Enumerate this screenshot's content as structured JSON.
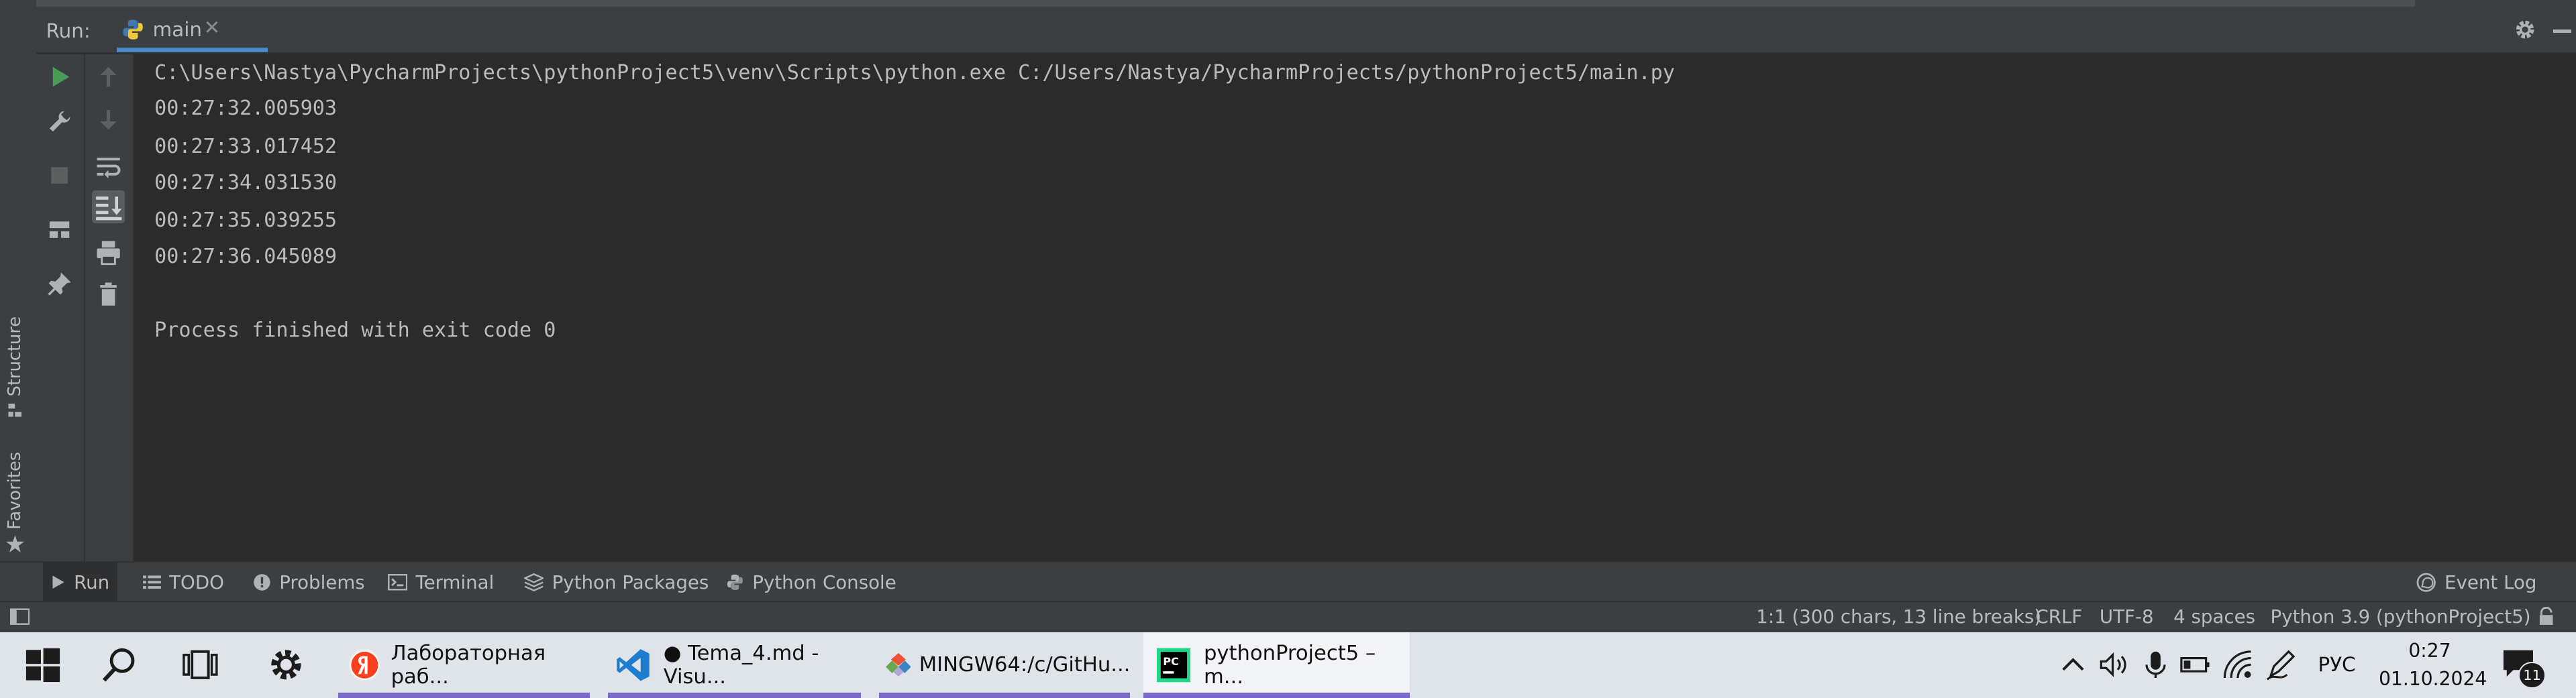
{
  "run_panel": {
    "label": "Run:",
    "tab_label": "main"
  },
  "side_tabs": {
    "structure": "Structure",
    "favorites": "Favorites"
  },
  "console_lines": [
    "C:\\Users\\Nastya\\PycharmProjects\\pythonProject5\\venv\\Scripts\\python.exe C:/Users/Nastya/PycharmProjects/pythonProject5/main.py",
    "00:27:32.005903",
    "00:27:33.017452",
    "00:27:34.031530",
    "00:27:35.039255",
    "00:27:36.045089",
    "",
    "Process finished with exit code 0"
  ],
  "bottom_tabs": [
    {
      "label": "Run",
      "icon": "play-icon"
    },
    {
      "label": "TODO",
      "icon": "list-icon"
    },
    {
      "label": "Problems",
      "icon": "problems-icon"
    },
    {
      "label": "Terminal",
      "icon": "terminal-icon"
    },
    {
      "label": "Python Packages",
      "icon": "packages-icon"
    },
    {
      "label": "Python Console",
      "icon": "python-console-icon"
    }
  ],
  "event_log": "Event Log",
  "status": {
    "position": "1:1 (300 chars, 13 line breaks)",
    "line_sep": "CRLF",
    "encoding": "UTF-8",
    "indent": "4 spaces",
    "interpreter": "Python 3.9 (pythonProject5)"
  },
  "taskbar": {
    "apps": [
      {
        "label": "Лабораторная раб..."
      },
      {
        "label": "● Tema_4.md - Visu..."
      },
      {
        "label": "MINGW64:/c/GitHu..."
      },
      {
        "label": "pythonProject5 – m..."
      }
    ],
    "lang": "РУС",
    "time": "0:27",
    "date": "01.10.2024",
    "notif_count": "11"
  },
  "colors": {
    "accent": "#4a88c7",
    "run_green": "#499c54",
    "taskbar_accent": "#7a69c9"
  }
}
